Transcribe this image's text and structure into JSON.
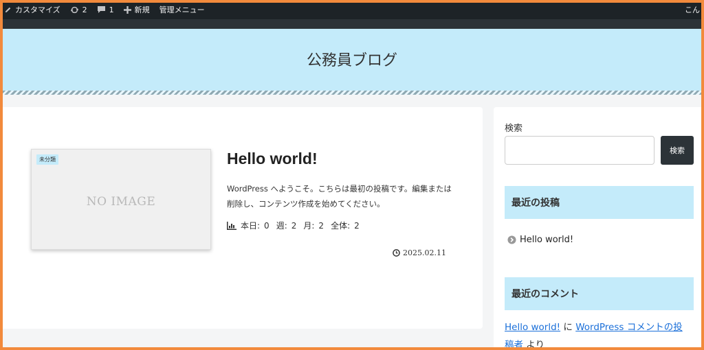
{
  "adminbar": {
    "customize": "カスタマイズ",
    "updates_count": "2",
    "comments_count": "1",
    "new_label": "新規",
    "admin_menu": "管理メニュー",
    "greeting": "こん"
  },
  "header": {
    "site_title": "公務員ブログ"
  },
  "post": {
    "category": "未分類",
    "noimage": "NO IMAGE",
    "title": "Hello world!",
    "excerpt": "WordPress へようこそ。こちらは最初の投稿です。編集または削除し、コンテンツ作成を始めてください。",
    "views": {
      "today_label": "本日:",
      "today": "0",
      "week_label": "週:",
      "week": "2",
      "month_label": "月:",
      "month": "2",
      "total_label": "全体:",
      "total": "2"
    },
    "date": "2025.02.11"
  },
  "sidebar": {
    "search_label": "検索",
    "search_button": "検索",
    "search_value": "",
    "recent_posts_title": "最近の投稿",
    "recent_post_item": "Hello world!",
    "recent_comments_title": "最近のコメント",
    "comment": {
      "post_link": "Hello world!",
      "connector": " に ",
      "author_link": "WordPress コメントの投稿者",
      "suffix": " より"
    }
  }
}
